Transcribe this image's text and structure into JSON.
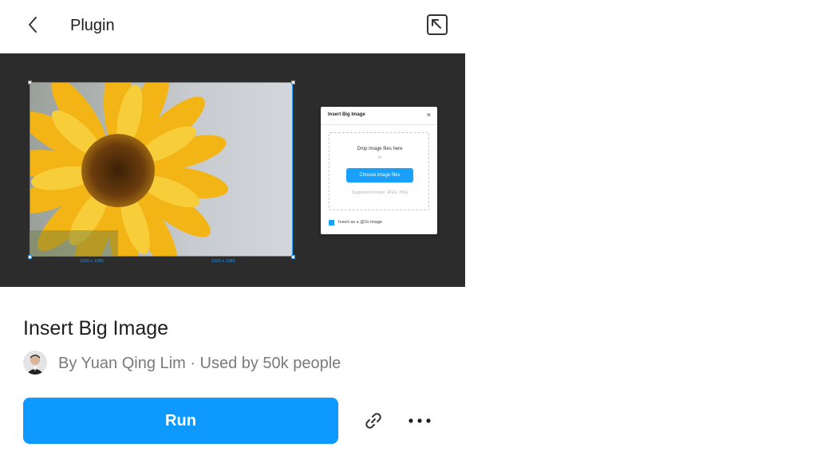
{
  "header": {
    "title": "Plugin",
    "back_icon": "chevron-left-icon",
    "popout_icon": "arrow-up-left-box-icon"
  },
  "preview": {
    "dialog_title": "Insert Big Image",
    "drop_text": "Drop image files here",
    "or_text": "or",
    "choose_button": "Choose image files",
    "supported_formats": "Supported formats: JPEG, PNG",
    "checkbox_label": "Insert as a @2x image",
    "dim_label_left": "1920 x 1080",
    "dim_label_right": "1920 x 1080"
  },
  "plugin": {
    "name": "Insert Big Image",
    "byline": "By Yuan Qing Lim · Used by 50k people"
  },
  "actions": {
    "run_label": "Run",
    "link_icon": "link-icon",
    "more_icon": "more-horizontal-icon"
  },
  "colors": {
    "accent": "#0d99ff",
    "preview_bg": "#2c2c2c"
  }
}
